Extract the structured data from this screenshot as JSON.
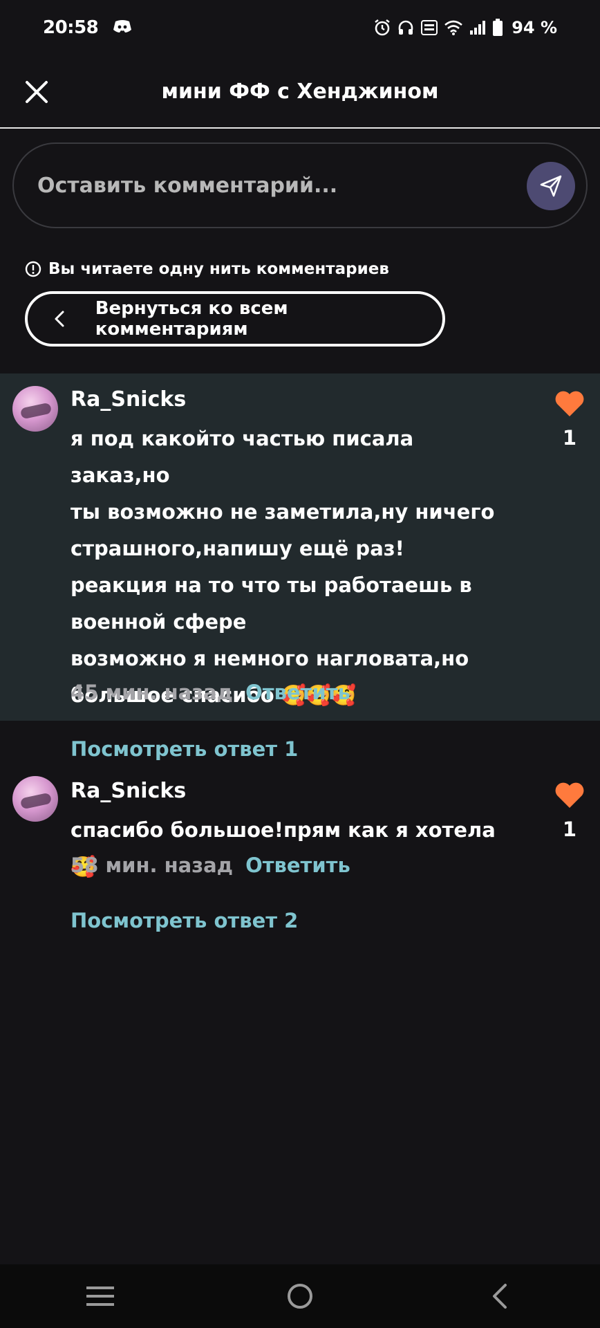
{
  "status_bar": {
    "time": "20:58",
    "battery": "94 %"
  },
  "header": {
    "title": "мини ФФ с Хенджином"
  },
  "comment_input": {
    "placeholder": "Оставить комментарий..."
  },
  "thread_note": "Вы читаете одну нить комментариев",
  "back_button": "Вернуться ко всем комментариям",
  "comments": [
    {
      "username": "Ra_Snicks",
      "lines": [
        "я под какойто частью писала заказ,но",
        "ты возможно не заметила,ну ничего",
        "страшного,напишу ещё раз!",
        "реакция на то что ты работаешь в",
        "военной сфере",
        "возможно я немного нагловата,но",
        "большое спасибо 🥰🥰🥰"
      ],
      "time": "45 мин. назад",
      "reply_label": "Ответить",
      "likes": "1",
      "view_replies": "Посмотреть ответ 1"
    },
    {
      "username": "Ra_Snicks",
      "lines": [
        "спасибо большое!прям как я хотела🥰"
      ],
      "time": "58 мин. назад",
      "reply_label": "Ответить",
      "likes": "1",
      "view_replies": "Посмотреть ответ 2"
    }
  ],
  "colors": {
    "background": "#141316",
    "highlight": "#222a2d",
    "accent_link": "#7fc4cf",
    "like": "#ff7a3d",
    "send_button": "#4d4a72"
  }
}
